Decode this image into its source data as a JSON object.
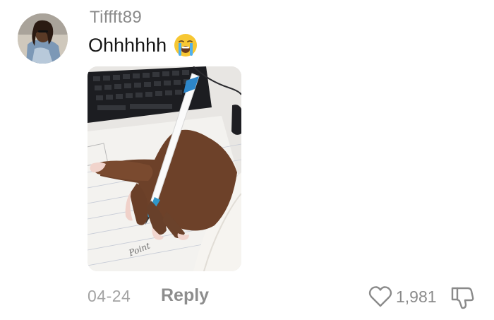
{
  "comment": {
    "username": "Tiffft89",
    "text": "Ohhhhhh",
    "emoji": "loudly-crying-face",
    "photo_note": "Point",
    "date": "04-24",
    "reply_label": "Reply",
    "like_count": "1,981",
    "liked": false
  },
  "icons": {
    "like": "heart-outline-icon",
    "dislike": "thumbs-down-outline-icon"
  },
  "colors": {
    "username": "#8a8a8a",
    "text": "#161616",
    "meta": "#a3a3a3"
  }
}
